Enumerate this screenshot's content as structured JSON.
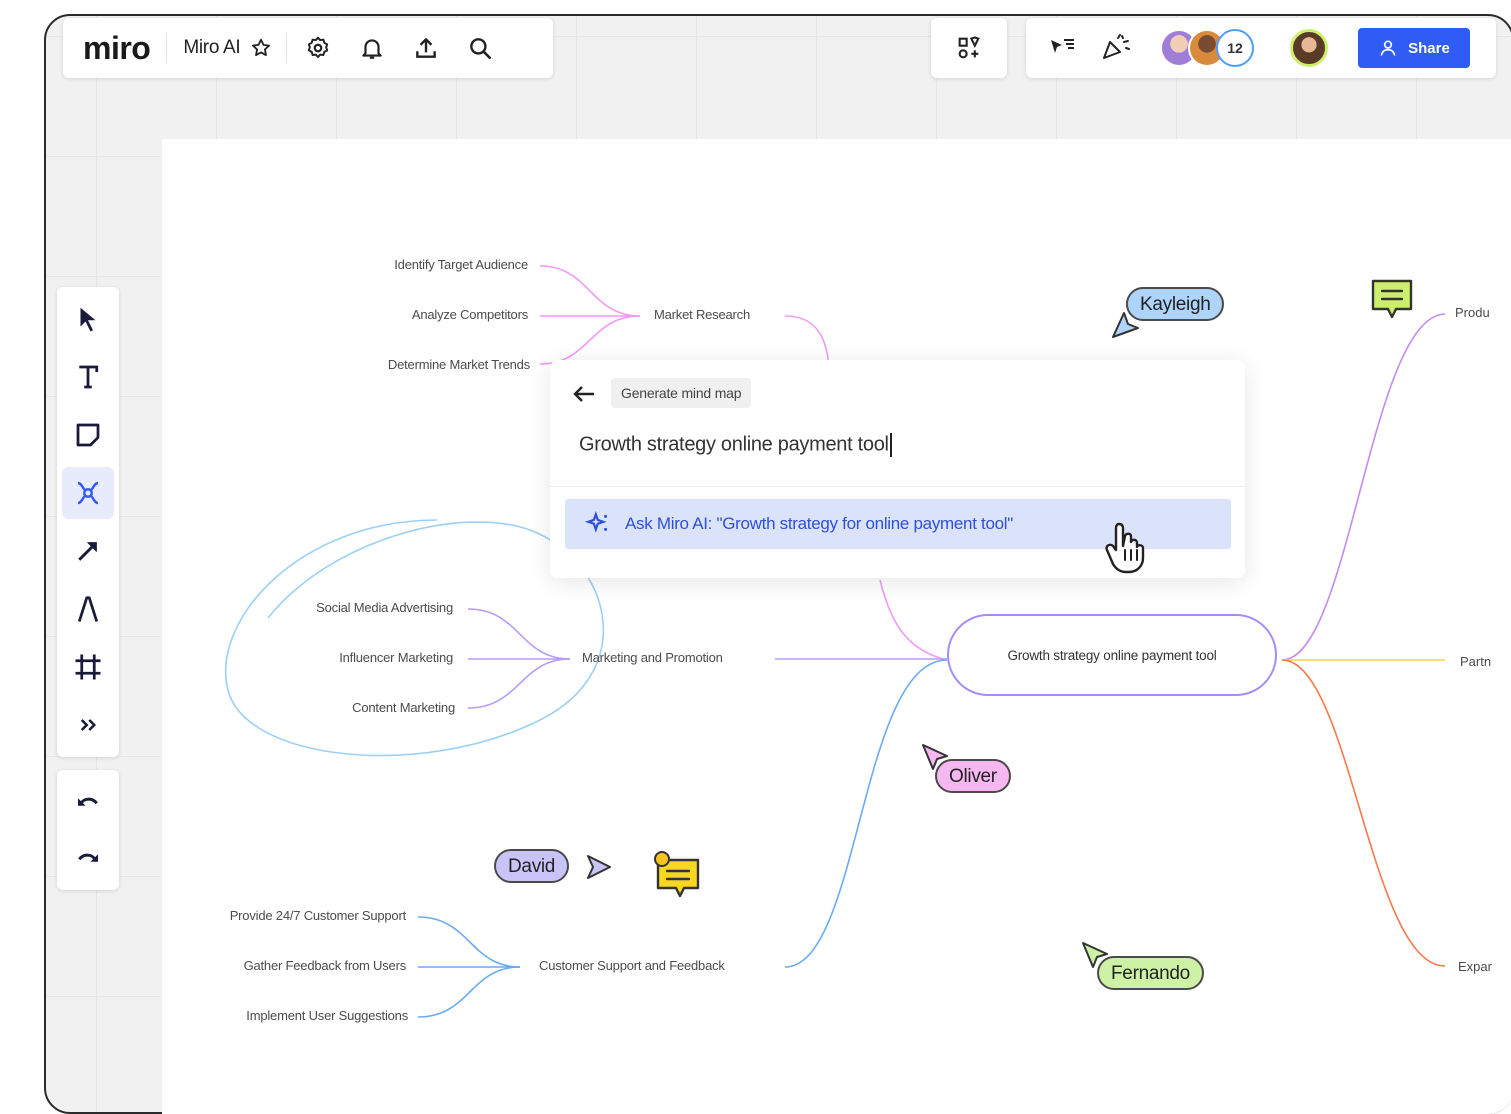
{
  "app": {
    "logo": "miro",
    "board_name": "Miro AI"
  },
  "topbar": {
    "icons": [
      "star-icon",
      "settings-icon",
      "bell-icon",
      "upload-icon",
      "search-icon",
      "apps-icon",
      "reactions-icon",
      "celebrate-icon"
    ],
    "collaborator_count": "12",
    "share_label": "Share"
  },
  "toolbar": {
    "tools": [
      "select",
      "text",
      "sticky-note",
      "mind-map",
      "arrow",
      "pen",
      "frame",
      "more"
    ],
    "history": [
      "undo",
      "redo"
    ]
  },
  "ai_popup": {
    "chip": "Generate mind map",
    "input_value": "Growth strategy online payment tool",
    "suggestion": "Ask Miro AI: \"Growth strategy for online payment tool\""
  },
  "mindmap": {
    "center": "Growth strategy online payment tool",
    "market_research": {
      "label": "Market Research",
      "children": [
        "Identify Target Audience",
        "Analyze Competitors",
        "Determine Market Trends"
      ]
    },
    "marketing": {
      "label": "Marketing and Promotion",
      "children": [
        "Social Media Advertising",
        "Influencer Marketing",
        "Content Marketing"
      ]
    },
    "support": {
      "label": "Customer Support and Feedback",
      "children": [
        "Provide 24/7 Customer Support",
        "Gather Feedback from Users",
        "Implement User Suggestions"
      ]
    },
    "right_branches": [
      "Produ",
      "Partn",
      "Expar"
    ]
  },
  "cursors": {
    "kayleigh": "Kayleigh",
    "oliver": "Oliver",
    "david": "David",
    "fernando": "Fernando"
  },
  "colors": {
    "accent_blue": "#2f5cf5",
    "market_branch": "#f09af5",
    "marketing_branch": "#b69cf7",
    "support_branch": "#6aaaf5",
    "yellow_branch": "#f7d34a",
    "orange_branch": "#f7794a",
    "kayleigh": "#aed4fb",
    "oliver": "#f7b8f2",
    "david": "#c9c4f7",
    "fernando": "#cdf2a6"
  }
}
